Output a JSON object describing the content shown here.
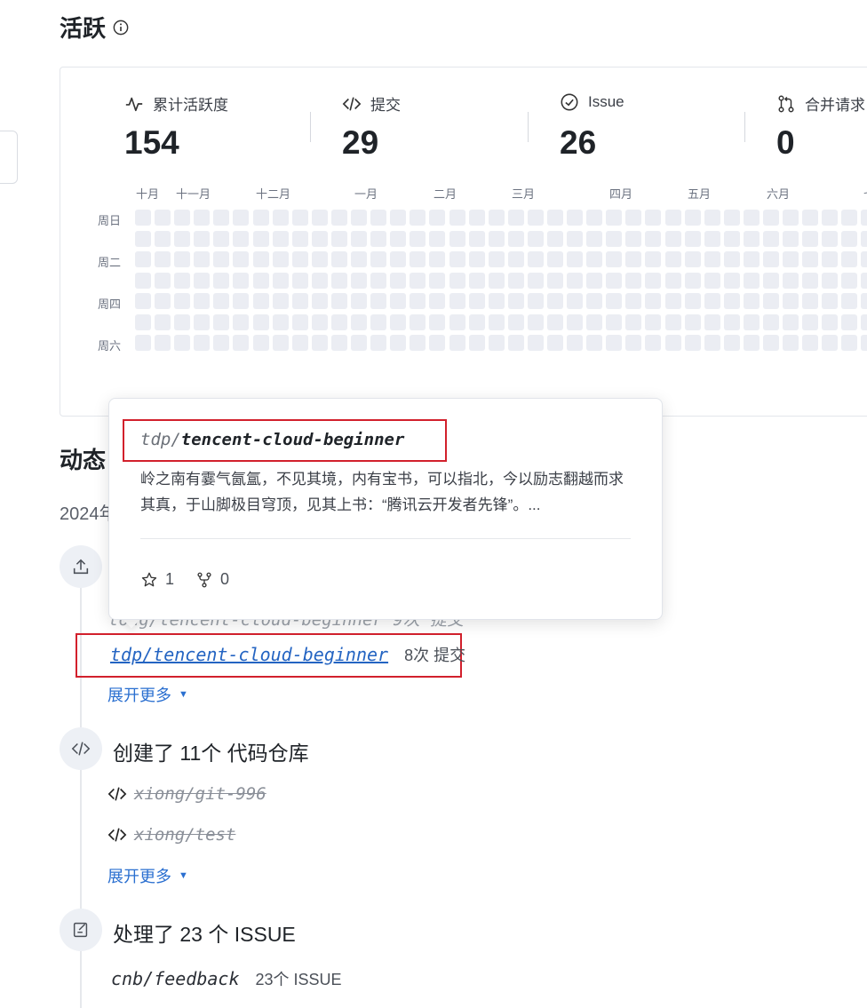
{
  "activity": {
    "title": "活跃",
    "stats": [
      {
        "label": "累计活跃度",
        "value": "154",
        "icon": "activity-pulse-icon"
      },
      {
        "label": "提交",
        "value": "29",
        "icon": "code-icon"
      },
      {
        "label": "Issue",
        "value": "26",
        "icon": "check-circle-icon"
      },
      {
        "label": "合并请求",
        "value": "0",
        "icon": "pull-request-icon"
      }
    ],
    "months": [
      "十月",
      "十一月",
      "十二月",
      "一月",
      "二月",
      "三月",
      "四月",
      "五月",
      "六月",
      "七"
    ],
    "weekdays": [
      "周日",
      "周二",
      "周四",
      "周六"
    ]
  },
  "dynamics": {
    "title": "动态",
    "date": "2024年",
    "commit_event": {
      "ghost_text": "tong/tencent-cloud-beginner  9次 提交",
      "repo_owner": "tdp/",
      "repo_name": "tencent-cloud-beginner",
      "repo_full": "tdp/tencent-cloud-beginner",
      "commits": "8次 提交",
      "expand": "展开更多"
    },
    "repo_event": {
      "title": "创建了 11个 代码仓库",
      "repos": [
        "xiong/git-996",
        "xiong/test"
      ],
      "expand": "展开更多"
    },
    "issue_event": {
      "title": "处理了 23 个 ISSUE",
      "repo": "cnb/feedback",
      "count": "23个 ISSUE"
    }
  },
  "popup": {
    "owner": "tdp/",
    "name": "tencent-cloud-beginner",
    "description": "岭之南有霎气氤氲，不见其境，内有宝书，可以指北，今以励志翻越而求其真，于山脚极目穹顶，见其上书：“腾讯云开发者先锋”。...",
    "stars": "1",
    "forks": "0"
  },
  "colors": {
    "accent": "#2a6fd0",
    "highlight_box": "#d2202c",
    "heatmap_empty": "#ebedf3"
  }
}
